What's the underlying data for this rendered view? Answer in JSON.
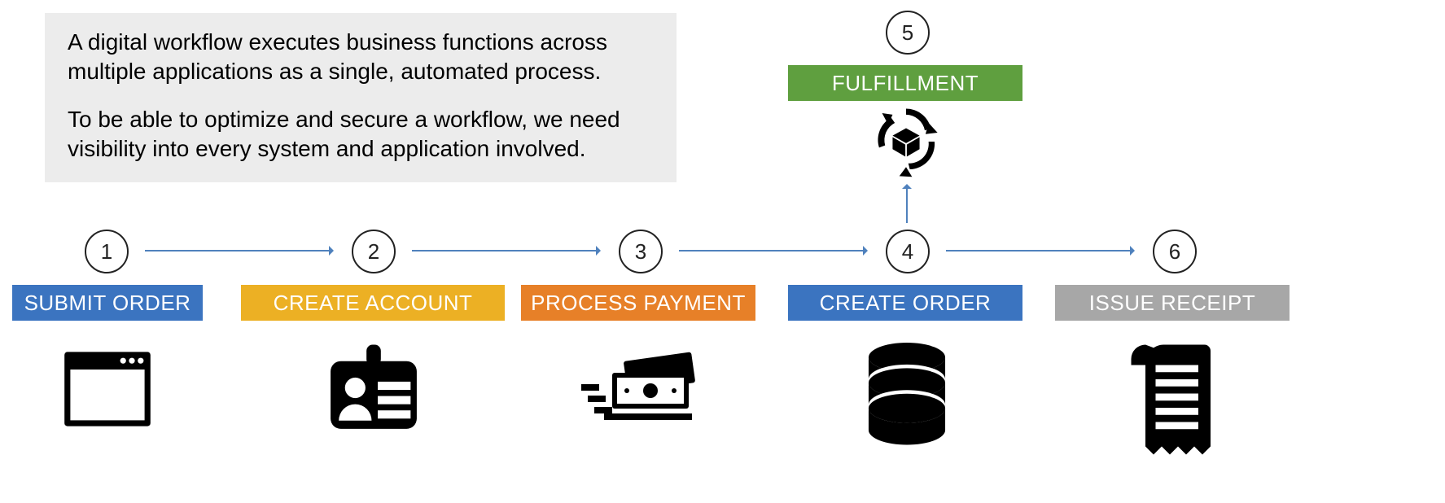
{
  "callout": {
    "p1": "A digital workflow executes business functions across multiple applications as a single, automated process.",
    "p2": "To be able to optimize and secure a workflow, we need visibility into every system and application involved."
  },
  "steps": {
    "s1": {
      "num": "1",
      "label": "SUBMIT ORDER"
    },
    "s2": {
      "num": "2",
      "label": "CREATE ACCOUNT"
    },
    "s3": {
      "num": "3",
      "label": "PROCESS PAYMENT"
    },
    "s4": {
      "num": "4",
      "label": "CREATE ORDER"
    },
    "s5": {
      "num": "5",
      "label": "FULFILLMENT"
    },
    "s6": {
      "num": "6",
      "label": "ISSUE RECEIPT"
    }
  },
  "chart_data": {
    "type": "flow",
    "nodes": [
      {
        "id": 1,
        "label": "SUBMIT ORDER",
        "color": "#3b74c0",
        "icon": "browser-window"
      },
      {
        "id": 2,
        "label": "CREATE ACCOUNT",
        "color": "#ecb024",
        "icon": "id-badge"
      },
      {
        "id": 3,
        "label": "PROCESS PAYMENT",
        "color": "#e78028",
        "icon": "cash"
      },
      {
        "id": 4,
        "label": "CREATE ORDER",
        "color": "#3b74c0",
        "icon": "database"
      },
      {
        "id": 5,
        "label": "FULFILLMENT",
        "color": "#5f9f3f",
        "icon": "package-cycle"
      },
      {
        "id": 6,
        "label": "ISSUE RECEIPT",
        "color": "#a7a7a7",
        "icon": "receipt"
      }
    ],
    "edges": [
      {
        "from": 1,
        "to": 2
      },
      {
        "from": 2,
        "to": 3
      },
      {
        "from": 3,
        "to": 4
      },
      {
        "from": 4,
        "to": 5
      },
      {
        "from": 4,
        "to": 6
      }
    ]
  }
}
